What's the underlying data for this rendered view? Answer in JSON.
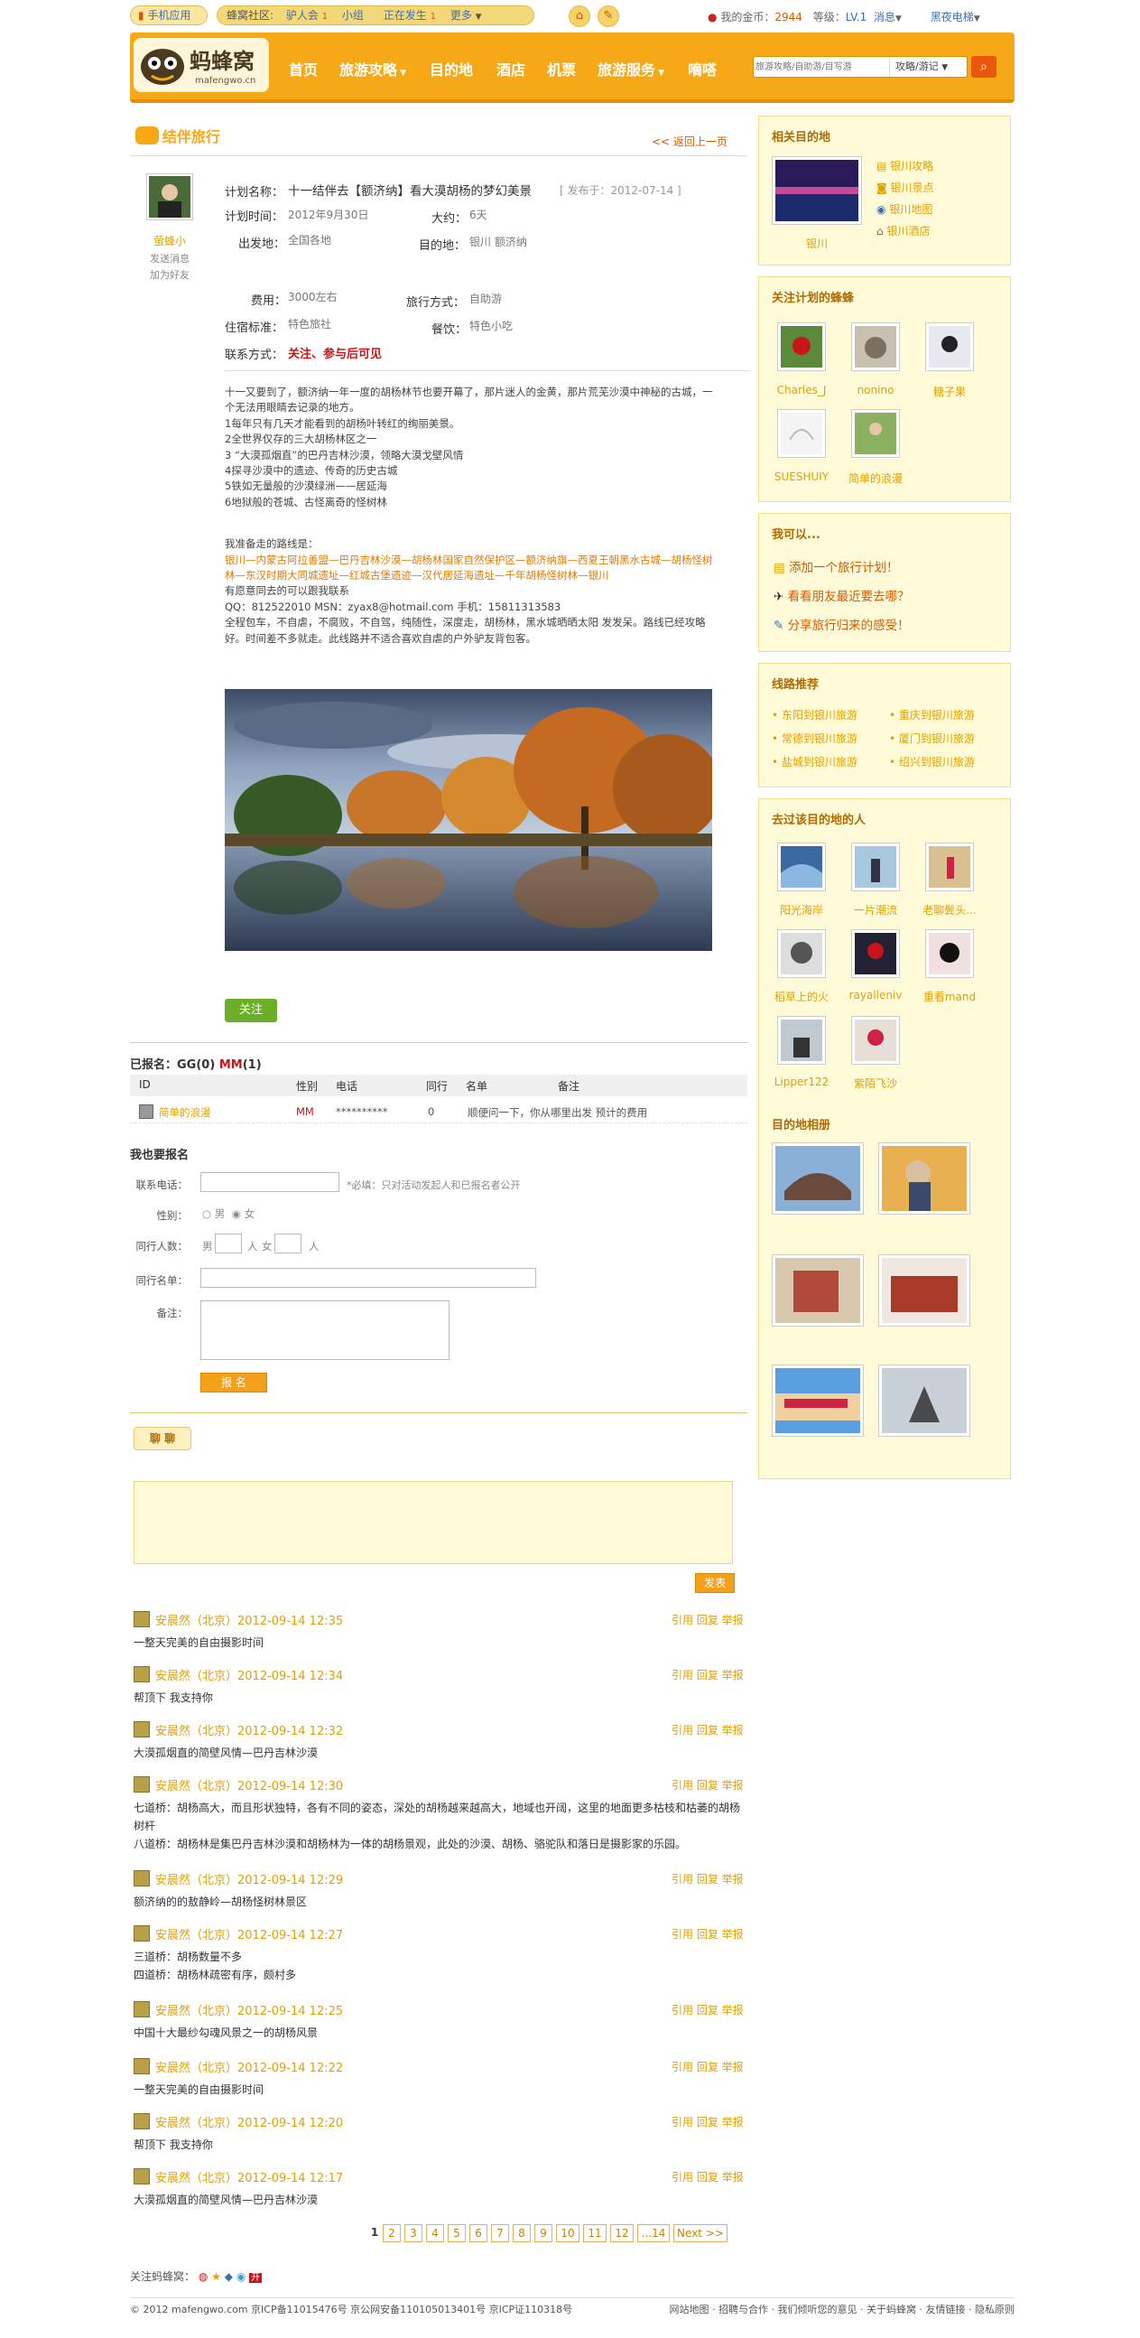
{
  "colors": {
    "brand": "#f7a816",
    "accent": "#e8570c",
    "link": "#e0a000",
    "green": "#6cae2a"
  },
  "topbar": {
    "mobile": "手机应用",
    "community": "蜂窝社区:",
    "c1": "驴人会",
    "c1_count": "1",
    "c2": "小组",
    "c3": "正在发生",
    "c3_count": "1",
    "more": "更多",
    "coins_label": "我的金币：",
    "coins": "2944",
    "level_label": "等级：",
    "level": "LV.1",
    "msg": "消息",
    "user": "黑夜电梯"
  },
  "header": {
    "logo_main": "蚂蜂窝",
    "logo_sub": "mafengwo.cn",
    "nav": [
      "首页",
      "旅游攻略",
      "目的地",
      "酒店",
      "机票",
      "旅游服务",
      "嘀嗒"
    ],
    "search_placeholder": "旅游攻略/自助游/目写游",
    "search_scope": "攻略/游记"
  },
  "main": {
    "section_title": "结伴旅行",
    "back": "<< 返回上一页",
    "user": {
      "name": "萤蜂小",
      "send_msg": "发送消息",
      "add_friend": "加为好友"
    },
    "plan_name_label": "计划名称：",
    "plan_name": "十一结伴去【额济纳】看大漠胡杨的梦幻美景",
    "published": "[ 发布于：2012-07-14 ]",
    "time_label": "计划时间：",
    "time": "2012年9月30日",
    "about_label": "大约：",
    "about": "6天",
    "from_label": "出发地：",
    "from": "全国各地",
    "dest_label": "目的地：",
    "dest": "银川  额济纳",
    "cost_label": "费用：",
    "cost": "3000左右",
    "mode_label": "旅行方式：",
    "mode": "自助游",
    "stay_label": "住宿标准：",
    "stay": "特色旅社",
    "food_label": "餐饮：",
    "food": "特色小吃",
    "contact_label": "联系方式：",
    "contact": "关注、参与后可见",
    "desc": [
      "十一又要到了，额济纳一年一度的胡杨林节也要开幕了，那片迷人的金黄，那片荒芜沙漠中神秘的古城，一",
      "个无法用眼睛去记录的地方。",
      "1每年只有几天才能看到的胡杨叶转红的绚丽美景。",
      "2全世界仅存的三大胡杨林区之一",
      "3 “大漠孤烟直”的巴丹吉林沙漠，领略大漠戈壁风情",
      "4探寻沙漠中的遗迹、传奇的历史古城",
      "5铁如无量般的沙漠绿洲——居延海",
      "6地狱般的苍城、古怪离奇的怪树林",
      "",
      "我准备走的路线是：",
      "银川—内蒙古阿拉善盟—巴丹吉林沙漠—胡杨林国家自然保护区—额济纳旗—西夏王朝黑水古城—胡杨怪树",
      "林—东汉时期大同城遗址—红城古堡遗迹—汉代居延海遗址—千年胡杨怪树林—银川",
      "有愿意同去的可以跟我联系",
      "QQ：812522010  MSN：zyax8@hotmail.com  手机：15811313583",
      "全程包车，不自虐，不腐败，不自驾，纯随性，深度走，胡杨林，黑水城晒晒太阳 发发呆。路线已经攻略",
      "好。时间差不多就走。此线路并不适合喜欢自虐的户外驴友背包客。"
    ],
    "follow_btn": "关注",
    "signed_label": "已报名：",
    "gg": "GG(0)",
    "mm": "MM",
    "mm_count": "(1)",
    "table_headers": [
      "ID",
      "性别",
      "电话",
      "同行",
      "名单",
      "备注"
    ],
    "table_rows": [
      {
        "id": "简单的浪漫",
        "gender": "MM",
        "phone": "**********",
        "with": "0",
        "list": "",
        "note": "顺便问一下，你从哪里出发 预计的费用"
      }
    ],
    "signup_title": "我也要报名",
    "phone_label": "联系电话：",
    "phone_hint": "*必填：只对活动发起人和已报名者公开",
    "gender_label": "性别：",
    "male": "男",
    "female": "女",
    "companions_label": "同行人数：",
    "comp_male": "男",
    "comp_unit": "人",
    "comp_female": "女",
    "names_label": "同行名单：",
    "note_label": "备注：",
    "signup_btn": "报 名",
    "chat_tab": "聊 聊",
    "send_btn": "发表",
    "comments": [
      {
        "name": "安晨然（北京）2012-09-14 12:35",
        "lines": [
          "一整天完美的自由摄影时间"
        ]
      },
      {
        "name": "安晨然（北京）2012-09-14 12:34",
        "lines": [
          "帮顶下 我支持你"
        ]
      },
      {
        "name": "安晨然（北京）2012-09-14 12:32",
        "lines": [
          "大漠孤烟直的简壁风情—巴丹吉林沙漠"
        ]
      },
      {
        "name": "安晨然（北京）2012-09-14 12:30",
        "lines": [
          "七道桥：胡杨高大，而且形状独特，各有不同的姿态，深处的胡杨越来越高大，地域也开阔，这里的地面更多枯枝和枯萎的胡杨",
          "树杆",
          "八道桥：胡杨林是集巴丹吉林沙漠和胡杨林为一体的胡杨景观，此处的沙漠、胡杨、骆驼队和落日是摄影家的乐园。"
        ]
      },
      {
        "name": "安晨然（北京）2012-09-14 12:29",
        "lines": [
          "额济纳的的敖静岭—胡杨怪树林景区"
        ]
      },
      {
        "name": "安晨然（北京）2012-09-14 12:27",
        "lines": [
          "三道桥：胡杨数量不多",
          "四道桥：胡杨林疏密有序，颇村多"
        ]
      },
      {
        "name": "安晨然（北京）2012-09-14 12:25",
        "lines": [
          "中国十大最纱勾魂风景之一的胡杨风景"
        ]
      },
      {
        "name": "安晨然（北京）2012-09-14 12:22",
        "lines": [
          "一整天完美的自由摄影时间"
        ]
      },
      {
        "name": "安晨然（北京）2012-09-14 12:20",
        "lines": [
          "帮顶下 我支持你"
        ]
      },
      {
        "name": "安晨然（北京）2012-09-14 12:17",
        "lines": [
          "大漠孤烟直的简壁风情—巴丹吉林沙漠"
        ]
      }
    ],
    "comment_actions": "引用 回复 举报",
    "pages": [
      "1",
      "2",
      "3",
      "4",
      "5",
      "6",
      "7",
      "8",
      "9",
      "10",
      "11",
      "12",
      "...14",
      "Next >>"
    ]
  },
  "sidebar": {
    "related_title": "相关目的地",
    "city": "银川",
    "city_links": [
      "银川攻略",
      "银川景点",
      "银川地图",
      "银川酒店"
    ],
    "followers_title": "关注计划的蜂蜂",
    "followers": [
      "Charles_J",
      "nonino",
      "糖子果",
      "SUESHUIY",
      "简单的浪漫"
    ],
    "can_title": "我可以...",
    "can": [
      "添加一个旅行计划！",
      "看看朋友最近要去哪？",
      "分享旅行归来的感受！"
    ],
    "routes_title": "线路推荐",
    "routes": [
      "东阳到银川旅游",
      "重庆到银川旅游",
      "常德到银川旅游",
      "厦门到银川旅游",
      "盐城到银川旅游",
      "绍兴到银川旅游"
    ],
    "visitors_title": "去过该目的地的人",
    "visitors": [
      "阳光海岸",
      "一片潮流",
      "老聊鬓头...",
      "稻草上的火",
      "rayalleniv",
      "重看mand",
      "Lipper122",
      "紫陌飞沙"
    ],
    "album_title": "目的地相册"
  },
  "footer": {
    "follow": "关注蚂蜂窝：",
    "copyright": "© 2012 mafengwo.com   京ICP备11015476号 京公网安备110105013401号 京ICP证110318号",
    "links": "网站地图 · 招聘与合作 · 我们倾听您的意见 · 关于蚂蜂窝 · 友情链接 · 隐私原则"
  }
}
